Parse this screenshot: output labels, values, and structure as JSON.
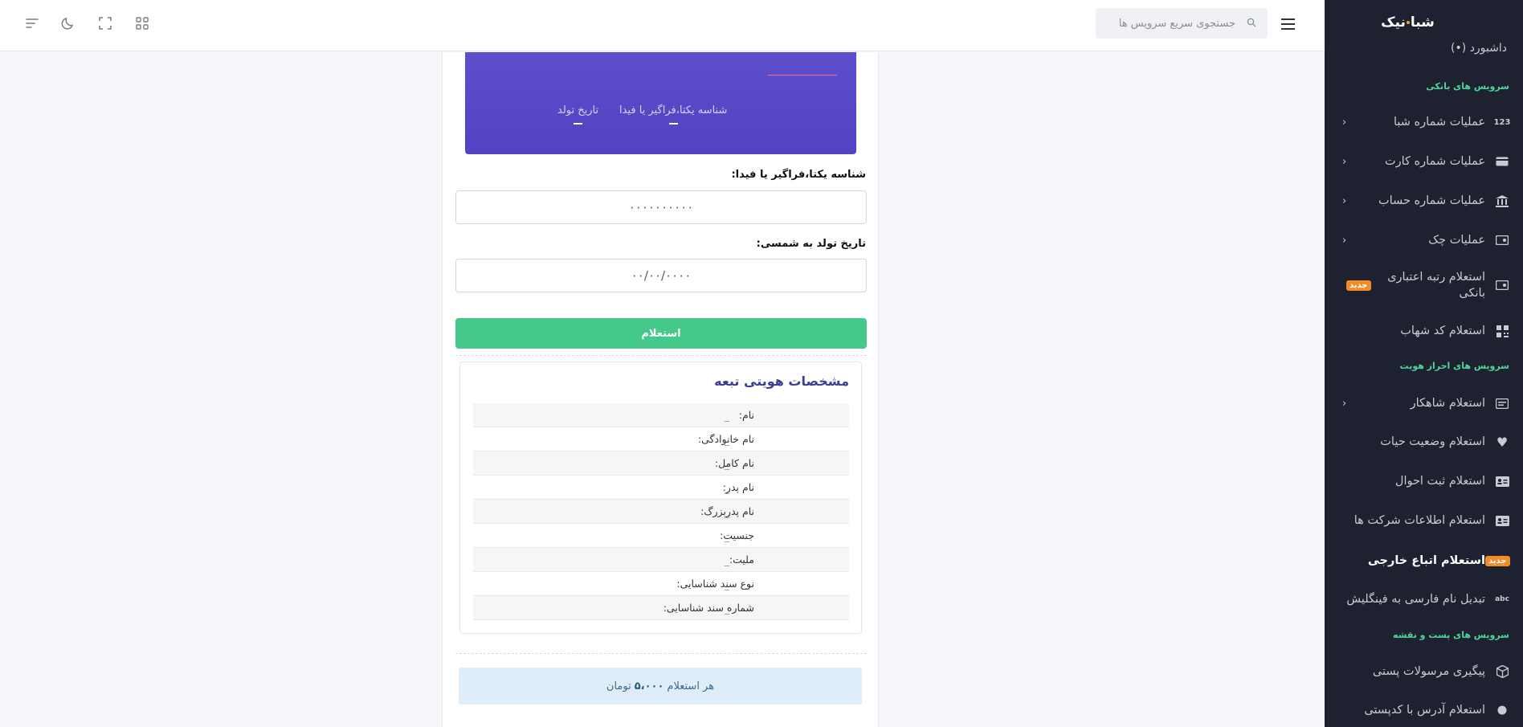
{
  "brand": {
    "name_part1": "شبا",
    "name_part2": "نیک"
  },
  "header": {
    "search_placeholder": "جستجوی سریع سرویس ها"
  },
  "sidebar": {
    "partial_item": "(•) داشبورد",
    "sections": [
      {
        "title": "سرویس های بانکی"
      },
      {
        "title": "سرویس های احراز هویت"
      },
      {
        "title": "سرویس های پست و نقشه"
      }
    ],
    "items": [
      {
        "label": "عملیات شماره شبا",
        "icon": "123"
      },
      {
        "label": "عملیات شماره کارت"
      },
      {
        "label": "عملیات شماره حساب"
      },
      {
        "label": "عملیات چک"
      },
      {
        "label": "استعلام رتبه اعتباری بانکی",
        "badge": "جدید"
      },
      {
        "label": "استعلام کد شهاب"
      },
      {
        "label": "استعلام شاهکار"
      },
      {
        "label": "استعلام وضعیت حیات"
      },
      {
        "label": "استعلام ثبت احوال"
      },
      {
        "label": "استعلام اطلاعات شرکت ها"
      },
      {
        "label": "استعلام اتباع خارجی",
        "badge": "جدید"
      },
      {
        "label": "تبدیل نام فارسی به فینگلیش",
        "icon": "abc"
      },
      {
        "label": "پیگیری مرسولات پستی"
      },
      {
        "label": "استعلام آدرس با کدپستی"
      }
    ]
  },
  "banner": {
    "field1": "شناسه یکتا،فراگیر یا فیدا",
    "field2": "تاریخ تولد"
  },
  "form": {
    "id_label": "شناسه یکتا،فراگیر یا فیدا:",
    "id_placeholder": "۰۰۰۰۰۰۰۰۰۰",
    "dob_label": "تاریخ تولد به شمسی:",
    "dob_placeholder": "۰۰/۰۰/۰۰۰۰",
    "submit_label": "استعلام"
  },
  "result": {
    "title": "مشخصات هویتی تبعه",
    "rows": [
      {
        "label": "نام:",
        "value": "_"
      },
      {
        "label": "نام خانوادگی:",
        "value": "_"
      },
      {
        "label": "نام کامل:",
        "value": "_"
      },
      {
        "label": "نام پدر:",
        "value": "_"
      },
      {
        "label": "نام پدربزرگ:",
        "value": "_"
      },
      {
        "label": "جنسیت:",
        "value": "_"
      },
      {
        "label": "ملیت:",
        "value": "_"
      },
      {
        "label": "نوع سند شناسایی:",
        "value": "_"
      },
      {
        "label": "شماره سند شناسایی:",
        "value": "_"
      }
    ]
  },
  "price": {
    "prefix": "هر استعلام",
    "amount": "۵،۰۰۰",
    "unit": "تومان"
  },
  "colors": {
    "sidebar_bg": "#1d2130",
    "accent_green": "#45c98a",
    "banner_purple": "#5342c2",
    "badge_orange": "#f28c28"
  }
}
